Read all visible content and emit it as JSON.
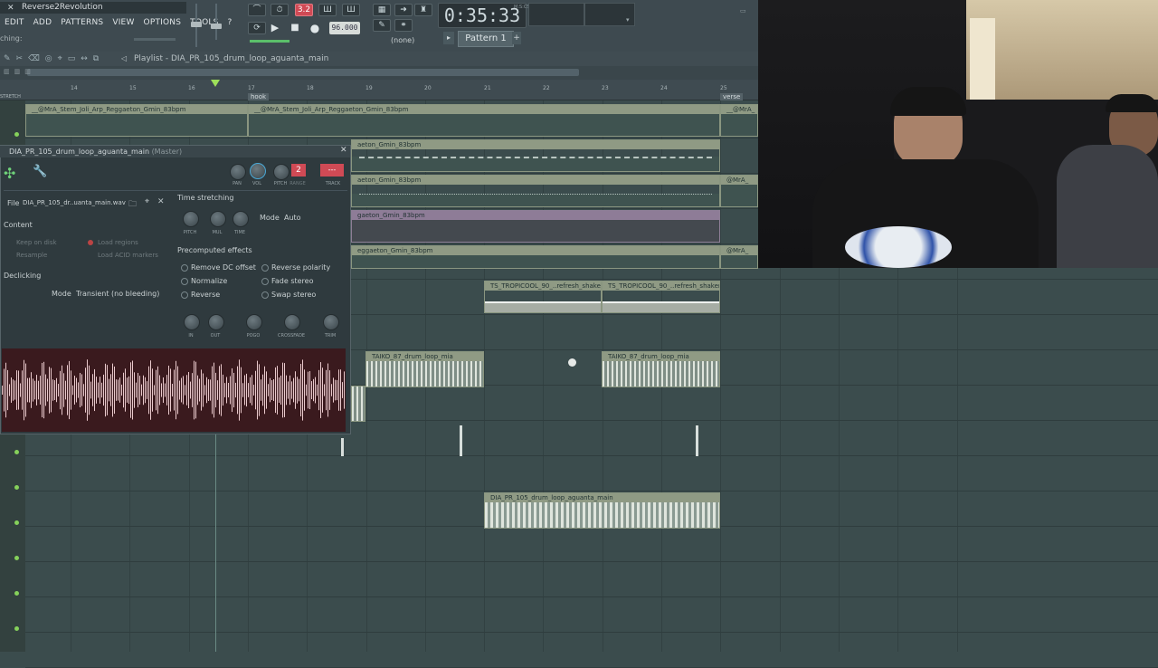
{
  "app": {
    "window_title": "Reverse2Revolution",
    "menu": [
      "EDIT",
      "ADD",
      "PATTERNS",
      "VIEW",
      "OPTIONS",
      "TOOLS",
      "?"
    ],
    "hint": "ching:",
    "time": "0:35:33",
    "time_unit": "M:S:CS",
    "tempo": "96.000",
    "pattern": "Pattern 1",
    "snap": "(none)",
    "pattern_number": "2"
  },
  "playlist": {
    "title": "Playlist - DIA_PR_105_drum_loop_aguanta_main",
    "ruler": [
      "14",
      "15",
      "16",
      "17",
      "18",
      "19",
      "20",
      "21",
      "22",
      "23",
      "24",
      "25"
    ],
    "markers": [
      "hook",
      "verse"
    ],
    "clips": [
      {
        "name": "__@MrA_Stem_Joli_Arp_Reggaeton_Gmin_83bpm"
      },
      {
        "name": "__@MrA_Stem_Joli_Arp_Reggaeton_Gmin_83bpm"
      },
      {
        "name": "__@MrA_"
      },
      {
        "name": "aeton_Gmin_83bpm"
      },
      {
        "name": "aeton_Gmin_83bpm"
      },
      {
        "name": "@MrA_"
      },
      {
        "name": "gaeton_Gmin_83bpm"
      },
      {
        "name": "eggaeton_Gmin_83bpm"
      },
      {
        "name": "@MrA_"
      },
      {
        "name": "TS_TROPICOOL_90_..refresh_shakers_2"
      },
      {
        "name": "TS_TROPICOOL_90_..refresh_shakers_2"
      },
      {
        "name": "TAIKO_87_drum_loop_mia"
      },
      {
        "name": "TAIKO_87_drum_loop_mia"
      },
      {
        "name": "DIA_PR_105_drum_loop_aguanta_main"
      }
    ],
    "track_label": "STRETCH"
  },
  "channel_settings": {
    "title": "DIA_PR_105_drum_loop_aguanta_main",
    "title_suffix": "(Master)",
    "knobs": [
      "PAN",
      "VOL",
      "PITCH",
      "RANGE",
      "TRACK"
    ],
    "file_label": "File",
    "file_value": "DIA_PR_105_dr..uanta_main.wav",
    "time_stretching": "Time stretching",
    "ts_knobs": [
      "PITCH",
      "MUL",
      "TIME"
    ],
    "mode_label": "Mode",
    "mode_value": "Auto",
    "content": "Content",
    "content_opts": [
      "Keep on disk",
      "Load regions",
      "Resample",
      "Load ACID markers"
    ],
    "declicking": "Declicking",
    "declick_mode_label": "Mode",
    "declick_mode_value": "Transient (no bleeding)",
    "precomputed": "Precomputed effects",
    "effects_left": [
      "Remove DC offset",
      "Normalize",
      "Reverse"
    ],
    "effects_right": [
      "Reverse polarity",
      "Fade stereo",
      "Swap stereo"
    ],
    "fx_knobs": [
      "IN",
      "OUT",
      "POGO",
      "CROSSFADE",
      "TRIM"
    ]
  },
  "colors": {
    "bg": "#3b4c4d",
    "clip_header": "#8f9a84",
    "accent_red": "#d04a55",
    "accent_green": "#86d15b"
  }
}
